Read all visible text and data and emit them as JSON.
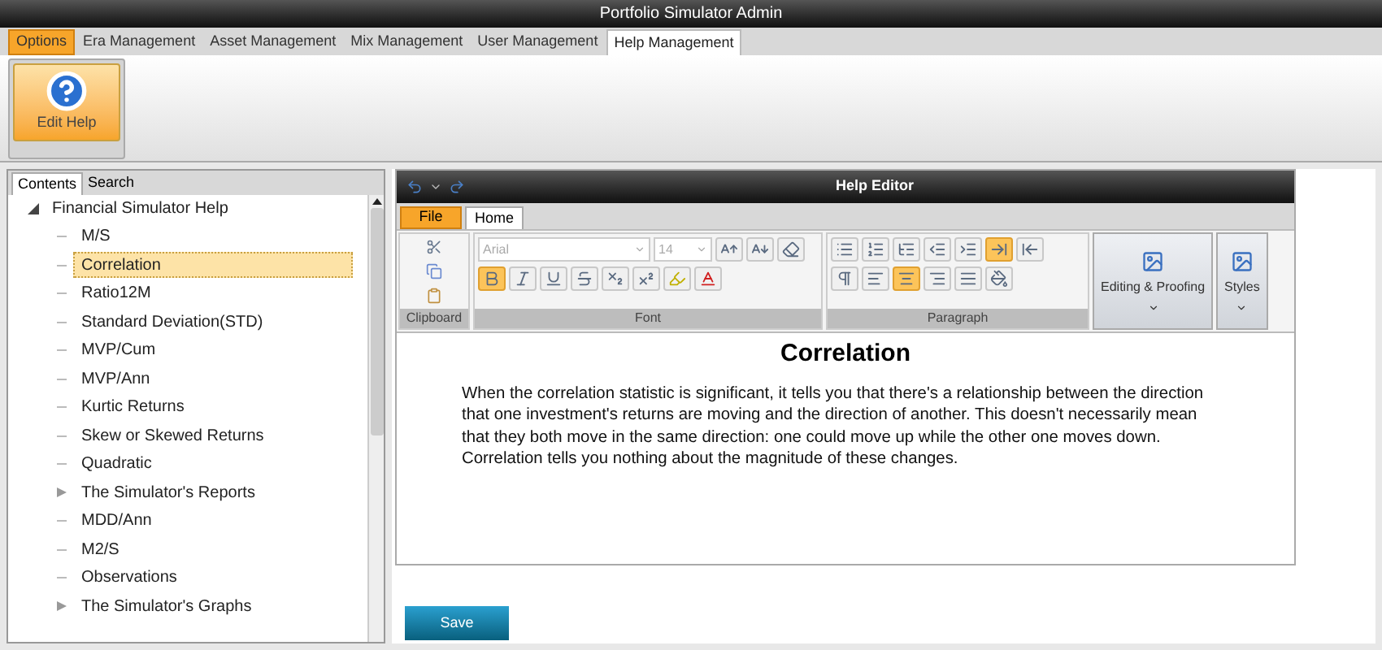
{
  "window": {
    "title": "Portfolio Simulator Admin"
  },
  "menu_tabs": [
    {
      "label": "Options",
      "selected": false,
      "kind": "app"
    },
    {
      "label": "Era Management",
      "selected": false,
      "kind": "tab"
    },
    {
      "label": "Asset Management",
      "selected": false,
      "kind": "tab"
    },
    {
      "label": "Mix Management",
      "selected": false,
      "kind": "tab"
    },
    {
      "label": "User Management",
      "selected": false,
      "kind": "tab"
    },
    {
      "label": "Help Management",
      "selected": true,
      "kind": "tab"
    }
  ],
  "ribbon": {
    "button": "Edit Help"
  },
  "side_tabs": [
    {
      "label": "Contents",
      "selected": true
    },
    {
      "label": "Search",
      "selected": false
    }
  ],
  "tree": {
    "label": "Financial Simulator Help",
    "expanded": true,
    "children": [
      {
        "label": "M/S",
        "kind": "topic",
        "selected": false
      },
      {
        "label": "Correlation",
        "kind": "topic",
        "selected": true
      },
      {
        "label": "Ratio12M",
        "kind": "topic",
        "selected": false
      },
      {
        "label": "Standard Deviation(STD)",
        "kind": "topic",
        "selected": false
      },
      {
        "label": "MVP/Cum",
        "kind": "topic",
        "selected": false
      },
      {
        "label": "MVP/Ann",
        "kind": "topic",
        "selected": false
      },
      {
        "label": "Kurtic Returns",
        "kind": "topic",
        "selected": false
      },
      {
        "label": "Skew or Skewed Returns",
        "kind": "topic",
        "selected": false
      },
      {
        "label": "Quadratic",
        "kind": "topic",
        "selected": false
      },
      {
        "label": "The Simulator's Reports",
        "kind": "group",
        "expanded": false,
        "selected": false
      },
      {
        "label": "MDD/Ann",
        "kind": "topic",
        "selected": false
      },
      {
        "label": "M2/S",
        "kind": "topic",
        "selected": false
      },
      {
        "label": "Observations",
        "kind": "topic",
        "selected": false
      },
      {
        "label": "The Simulator's Graphs",
        "kind": "group",
        "expanded": false,
        "selected": false
      }
    ]
  },
  "editor": {
    "title": "Help Editor",
    "tabs": [
      {
        "label": "File",
        "selected": false,
        "kind": "app"
      },
      {
        "label": "Home",
        "selected": true,
        "kind": "tab"
      }
    ],
    "font_name": "Arial",
    "font_size": "14",
    "groups": [
      "Clipboard",
      "Font",
      "Paragraph"
    ],
    "big_buttons": [
      "Editing & Proofing",
      "Styles"
    ],
    "heading": "Correlation",
    "body": "When the correlation statistic is significant, it tells you that there's a relationship between the direction that one investment's returns are moving and the direction of another. This doesn't necessarily mean that they both move in the same direction: one could move up while the other one moves down. Correlation tells you nothing about the magnitude of these changes."
  },
  "save_button": "Save"
}
